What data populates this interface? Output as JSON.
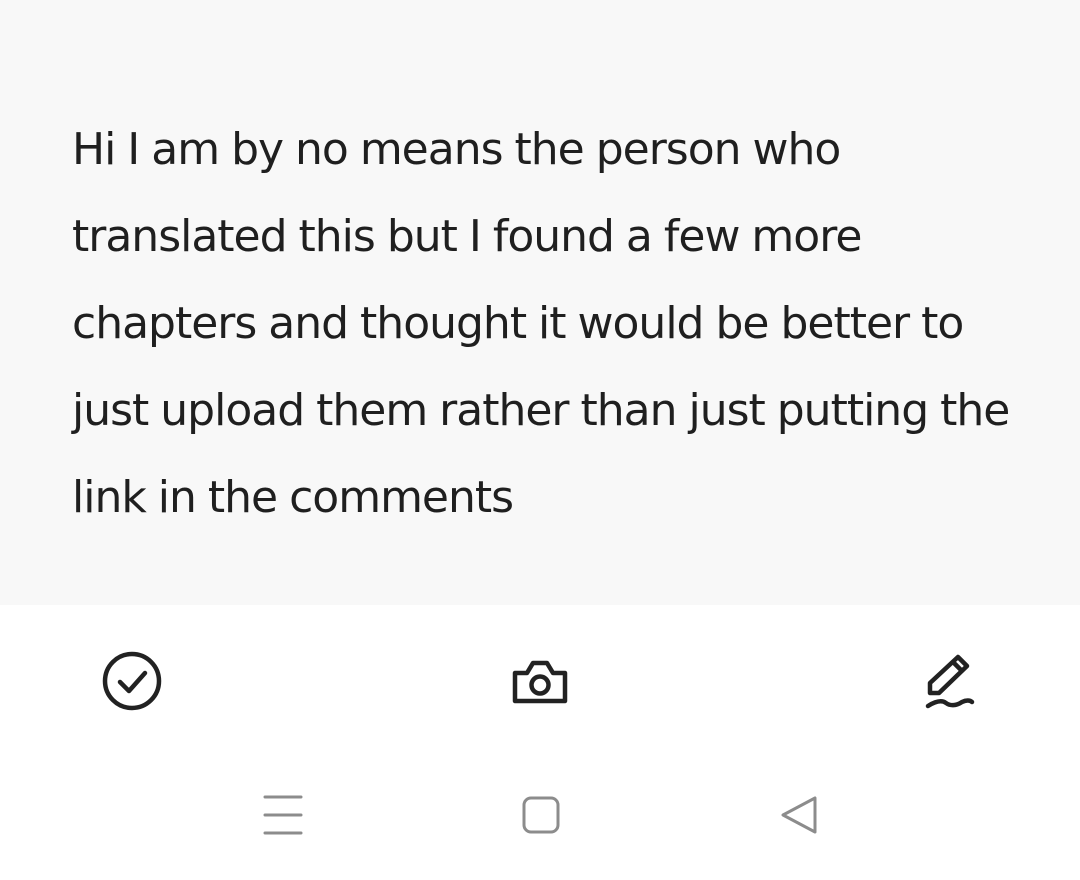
{
  "note": {
    "text": "Hi I am by no means the person who translated this but I found a few more chapters and thought it would be better to just upload them rather than just putting the link in the comments"
  },
  "toolbar": {
    "items": [
      {
        "icon": "check-circle-icon"
      },
      {
        "icon": "camera-icon"
      },
      {
        "icon": "pen-icon"
      }
    ]
  },
  "nav_bar": {
    "items": [
      {
        "icon": "menu-icon"
      },
      {
        "icon": "home-square-icon"
      },
      {
        "icon": "back-triangle-icon"
      }
    ]
  },
  "colors": {
    "note_background": "#f8f8f8",
    "text": "#1f1f1f",
    "icon": "#222222",
    "nav_icon": "#8c8c8c"
  }
}
